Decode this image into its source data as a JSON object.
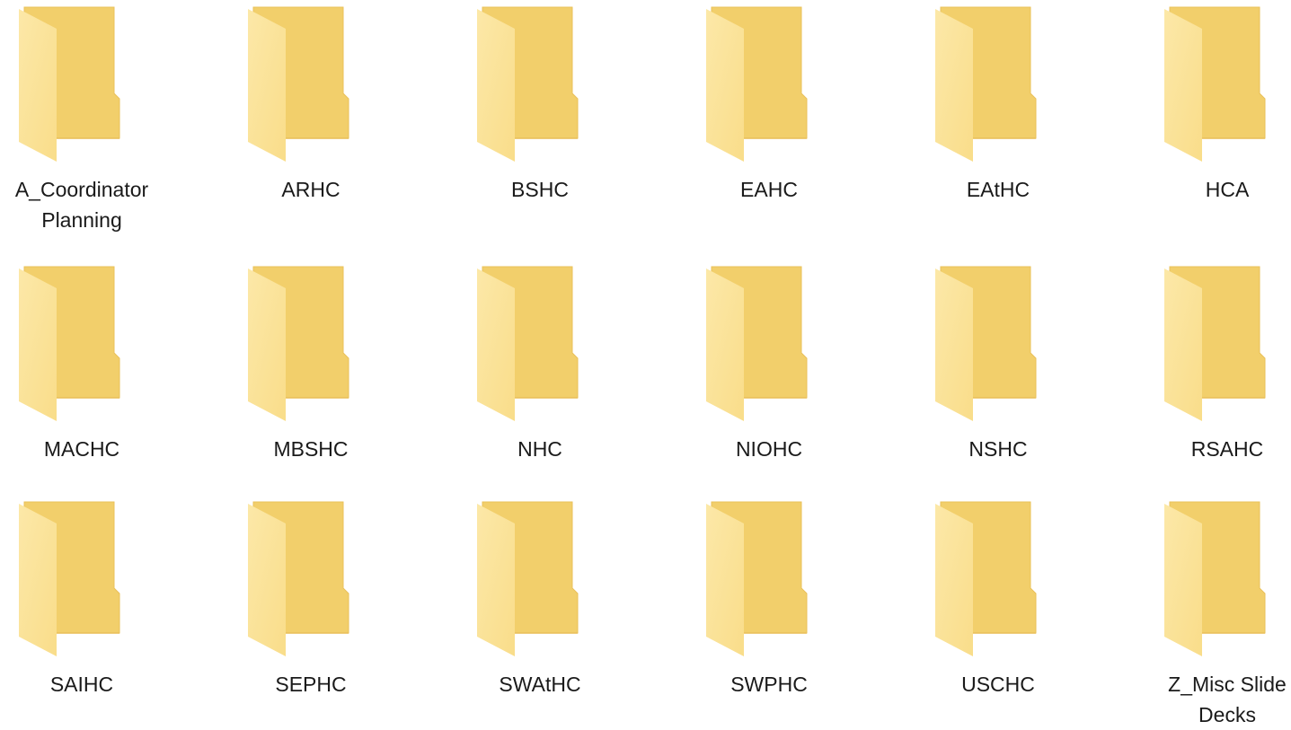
{
  "colors": {
    "folder_back": "#f2cf6b",
    "folder_back_edge": "#e9c05a",
    "folder_front": "#f9dd8a",
    "folder_front_light": "#fce8a8",
    "label_text": "#1a1a1a"
  },
  "icon_name": "folder-icon",
  "folders": [
    {
      "label": "A_Coordinator Planning"
    },
    {
      "label": "ARHC"
    },
    {
      "label": "BSHC"
    },
    {
      "label": "EAHC"
    },
    {
      "label": "EAtHC"
    },
    {
      "label": "HCA"
    },
    {
      "label": "MACHC"
    },
    {
      "label": "MBSHC"
    },
    {
      "label": "NHC"
    },
    {
      "label": "NIOHC"
    },
    {
      "label": "NSHC"
    },
    {
      "label": "RSAHC"
    },
    {
      "label": "SAIHC"
    },
    {
      "label": "SEPHC"
    },
    {
      "label": "SWAtHC"
    },
    {
      "label": "SWPHC"
    },
    {
      "label": "USCHC"
    },
    {
      "label": "Z_Misc Slide Decks"
    }
  ]
}
